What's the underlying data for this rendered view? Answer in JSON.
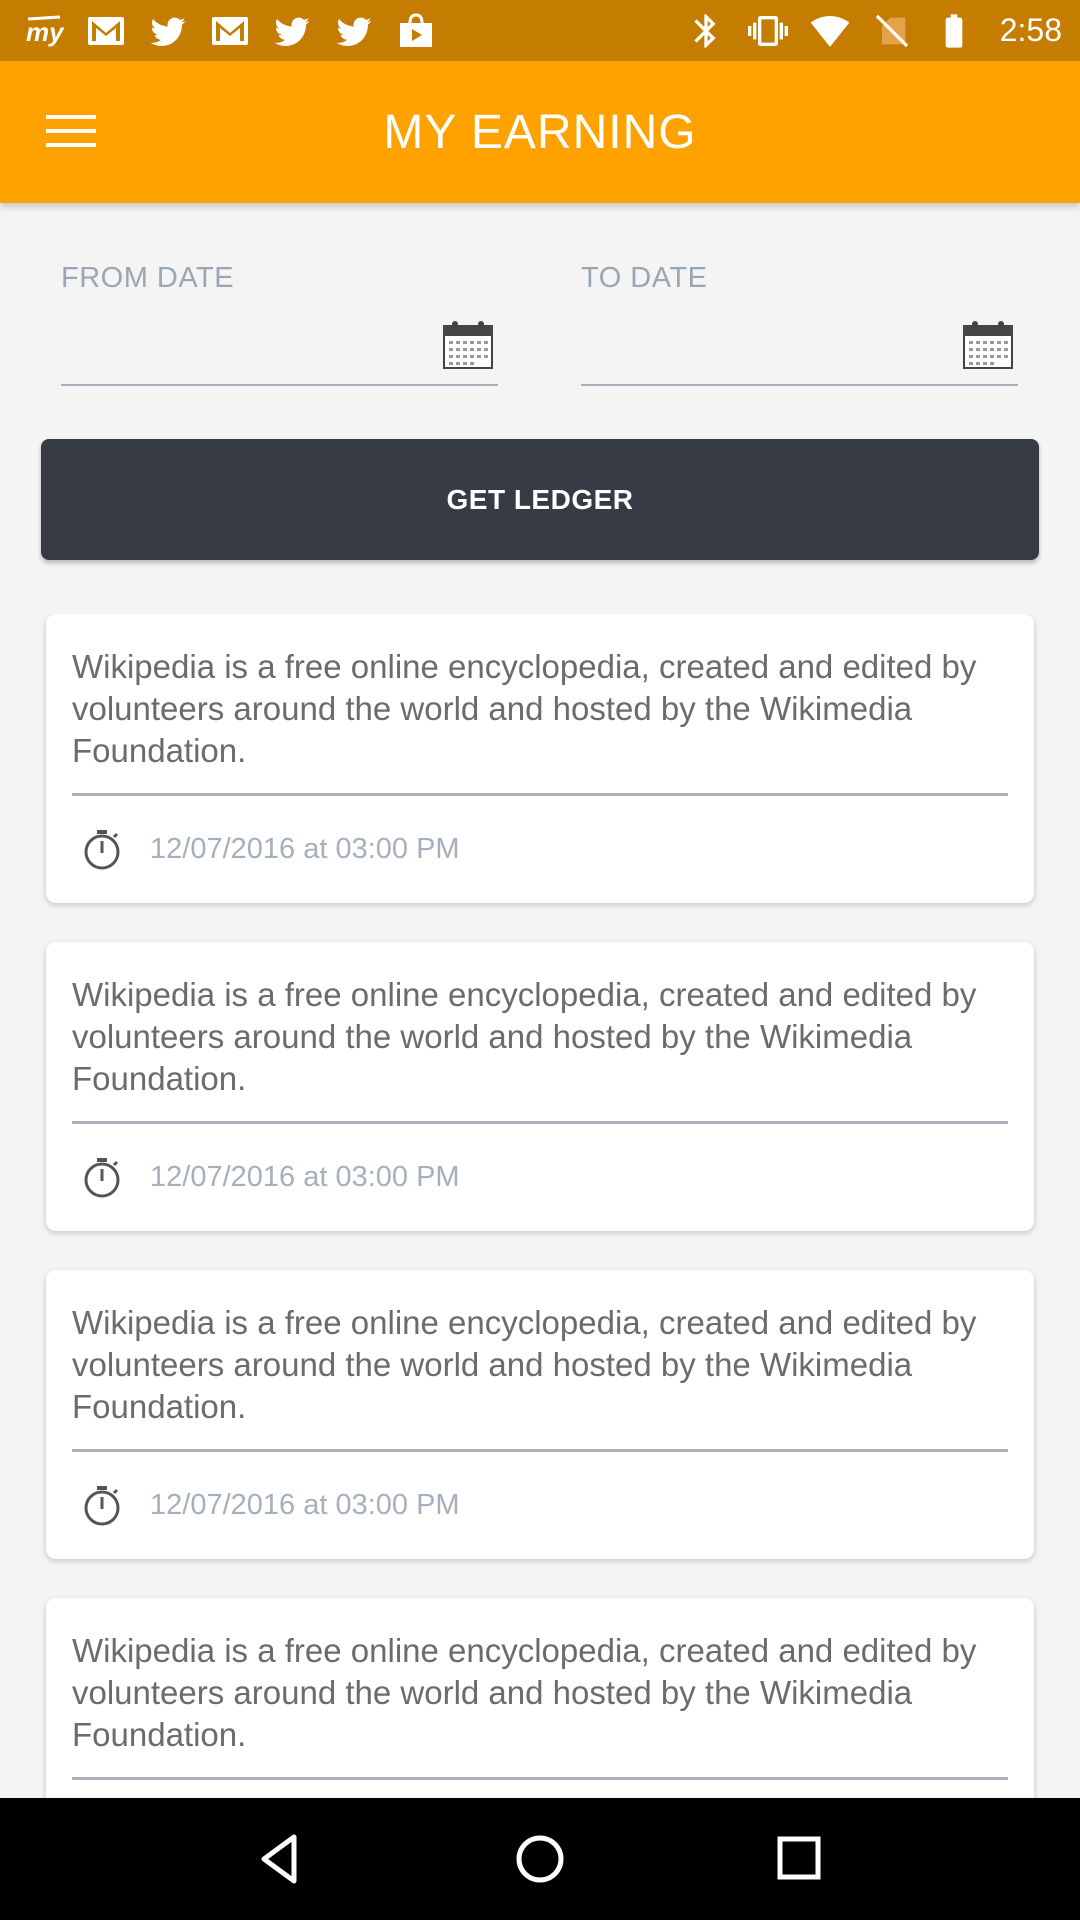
{
  "status_bar": {
    "left_icons": [
      "myntra-icon",
      "gmail-icon",
      "twitter-icon",
      "gmail-icon",
      "twitter-icon",
      "twitter-icon",
      "play-store-icon"
    ],
    "right_icons": [
      "bluetooth-icon",
      "vibrate-icon",
      "wifi-icon",
      "no-sim-icon",
      "battery-icon"
    ],
    "time": "2:58"
  },
  "app_bar": {
    "title": "MY EARNING",
    "menu_icon": "hamburger-menu-icon",
    "color": "#ffa200"
  },
  "filters": {
    "from_label": "FROM DATE",
    "from_value": "",
    "to_label": "TO DATE",
    "to_value": "",
    "calendar_icon": "calendar-icon"
  },
  "button": {
    "label": "GET LEDGER",
    "color": "#363b44"
  },
  "ledger": [
    {
      "text": "Wikipedia is a free online encyclopedia, created and edited by volunteers around the world and hosted by the Wikimedia Foundation.",
      "time": "12/07/2016 at 03:00 PM"
    },
    {
      "text": "Wikipedia is a free online encyclopedia, created and edited by volunteers around the world and hosted by the Wikimedia Foundation.",
      "time": "12/07/2016 at 03:00 PM"
    },
    {
      "text": "Wikipedia is a free online encyclopedia, created and edited by volunteers around the world and hosted by the Wikimedia Foundation.",
      "time": "12/07/2016 at 03:00 PM"
    },
    {
      "text": "Wikipedia is a free online encyclopedia, created and edited by volunteers around the world and hosted by the Wikimedia Foundation.",
      "time": ""
    }
  ],
  "nav_bar": {
    "icons": [
      "back-icon",
      "home-icon",
      "recents-icon"
    ]
  }
}
